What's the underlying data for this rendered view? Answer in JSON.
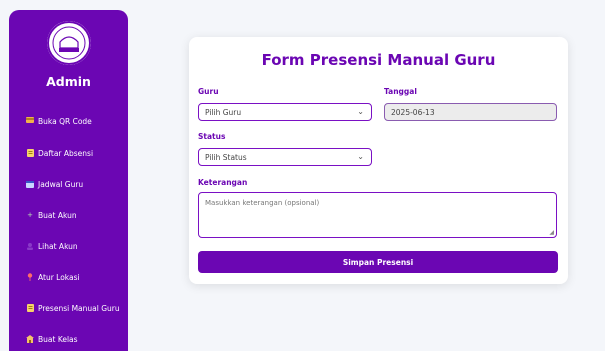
{
  "sidebar": {
    "title": "Admin",
    "items": [
      {
        "label": "Buka QR Code",
        "icon": "credit-card-icon",
        "color": "#f0b34a"
      },
      {
        "label": "Daftar Absensi",
        "icon": "clipboard-icon",
        "color": "#f6d36a"
      },
      {
        "label": "Jadwal Guru",
        "icon": "calendar-icon",
        "color": "#c9d6ff"
      },
      {
        "label": "Buat Akun",
        "icon": "plus-icon",
        "color": "#b7e0b0"
      },
      {
        "label": "Lihat Akun",
        "icon": "users-icon",
        "color": "#8a3ac8"
      },
      {
        "label": "Atur Lokasi",
        "icon": "pin-icon",
        "color": "#ff6a6a"
      },
      {
        "label": "Presensi Manual Guru",
        "icon": "document-icon",
        "color": "#f6d36a"
      },
      {
        "label": "Buat Kelas",
        "icon": "school-icon",
        "color": "#f3c36b"
      }
    ]
  },
  "form": {
    "title": "Form Presensi Manual Guru",
    "guru_label": "Guru",
    "guru_value": "Pilih Guru",
    "tanggal_label": "Tanggal",
    "tanggal_value": "2025-06-13",
    "status_label": "Status",
    "status_value": "Pilih Status",
    "keterangan_label": "Keterangan",
    "keterangan_placeholder": "Masukkan keterangan (opsional)",
    "submit_label": "Simpan Presensi"
  },
  "colors": {
    "brand": "#6b06b3",
    "background": "#f4f6fa"
  }
}
